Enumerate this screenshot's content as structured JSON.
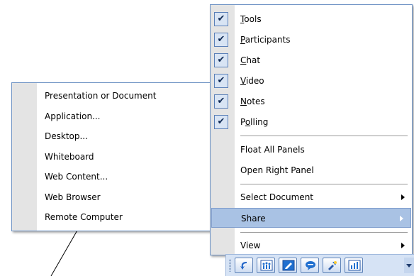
{
  "share_menu": {
    "items": [
      {
        "label": "Presentation or Document"
      },
      {
        "label": "Application..."
      },
      {
        "label": "Desktop..."
      },
      {
        "label": "Whiteboard"
      },
      {
        "label": "Web Content..."
      },
      {
        "label": "Web Browser"
      },
      {
        "label": "Remote Computer"
      }
    ]
  },
  "panel_menu": {
    "panels": [
      {
        "pre": "",
        "mnemonic": "T",
        "post": "ools",
        "checked": true
      },
      {
        "pre": "",
        "mnemonic": "P",
        "post": "articipants",
        "checked": true
      },
      {
        "pre": "",
        "mnemonic": "C",
        "post": "hat",
        "checked": true
      },
      {
        "pre": "",
        "mnemonic": "V",
        "post": "ideo",
        "checked": true
      },
      {
        "pre": "",
        "mnemonic": "N",
        "post": "otes",
        "checked": true
      },
      {
        "pre": "P",
        "mnemonic": "o",
        "post": "lling",
        "checked": true
      }
    ],
    "float_all": "Float All Panels",
    "open_right": "Open Right Panel",
    "select_document": "Select Document",
    "share": "Share",
    "view": "View",
    "highlighted_item": "Share"
  },
  "toolbar": {
    "buttons": [
      {
        "icon": "undo-arrow-icon"
      },
      {
        "icon": "participants-icon"
      },
      {
        "icon": "notes-icon"
      },
      {
        "icon": "chat-icon"
      },
      {
        "icon": "tools-icon"
      },
      {
        "icon": "polling-icon"
      }
    ]
  },
  "colors": {
    "menu_border": "#6e93c5",
    "gutter": "#e4e4e4",
    "highlight": "#a9c2e4",
    "check_bg": "#d8e4f4",
    "toolbar_bg": "#d6e3f5"
  }
}
